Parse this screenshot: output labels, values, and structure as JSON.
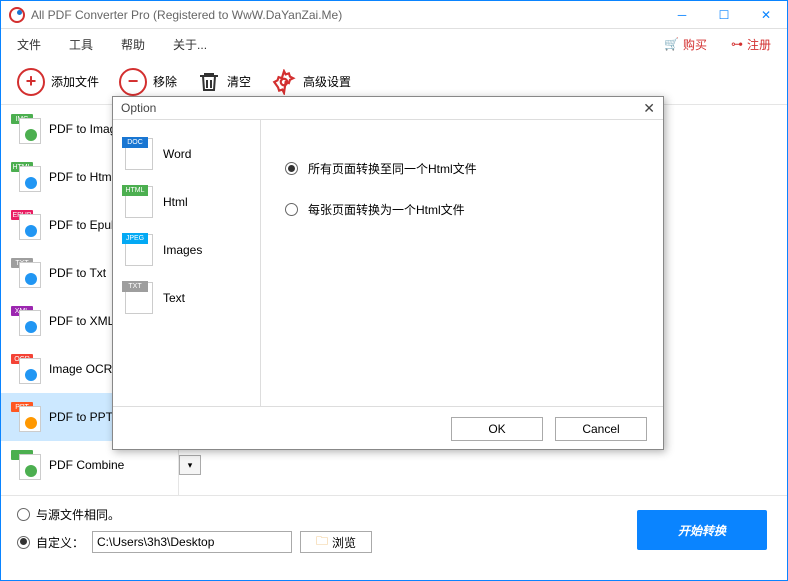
{
  "window": {
    "title": "All PDF Converter Pro (Registered to WwW.DaYanZai.Me)"
  },
  "menu": {
    "file": "文件",
    "tools": "工具",
    "help": "帮助",
    "about": "关于...",
    "buy": "购买",
    "register": "注册"
  },
  "toolbar": {
    "add": "添加文件",
    "remove": "移除",
    "clear": "清空",
    "advanced": "高级设置"
  },
  "sidebar": {
    "items": [
      {
        "label": "PDF to Image",
        "badge": "IMG",
        "color": "#4caf50",
        "dot": "#4caf50"
      },
      {
        "label": "PDF to Html",
        "badge": "HTML",
        "color": "#4caf50",
        "dot": "#2196f3"
      },
      {
        "label": "PDF to Epub",
        "badge": "EPUB",
        "color": "#e91e63",
        "dot": "#2196f3"
      },
      {
        "label": "PDF to Txt",
        "badge": "TXT",
        "color": "#9e9e9e",
        "dot": "#2196f3"
      },
      {
        "label": "PDF to XML",
        "badge": "XML",
        "color": "#9c27b0",
        "dot": "#2196f3"
      },
      {
        "label": "Image OCR",
        "badge": "OCR",
        "color": "#f44336",
        "dot": "#2196f3"
      },
      {
        "label": "PDF to PPTX",
        "badge": "PPT",
        "color": "#ff5722",
        "dot": "#ff9800"
      },
      {
        "label": "PDF Combine",
        "badge": "",
        "color": "#4caf50",
        "dot": "#4caf50"
      }
    ]
  },
  "bottom": {
    "same_as_source": "与源文件相同。",
    "custom": "自定义：",
    "path": "C:\\Users\\3h3\\Desktop",
    "browse": "浏览",
    "start": "开始转换"
  },
  "dialog": {
    "title": "Option",
    "formats": [
      {
        "label": "Word",
        "badge": "DOC",
        "color": "#1976d2"
      },
      {
        "label": "Html",
        "badge": "HTML",
        "color": "#4caf50"
      },
      {
        "label": "Images",
        "badge": "JPEG",
        "color": "#03a9f4"
      },
      {
        "label": "Text",
        "badge": "TXT",
        "color": "#9e9e9e"
      }
    ],
    "opt_all_one": "所有页面转换至同一个Html文件",
    "opt_each": "每张页面转换为一个Html文件",
    "ok": "OK",
    "cancel": "Cancel"
  }
}
